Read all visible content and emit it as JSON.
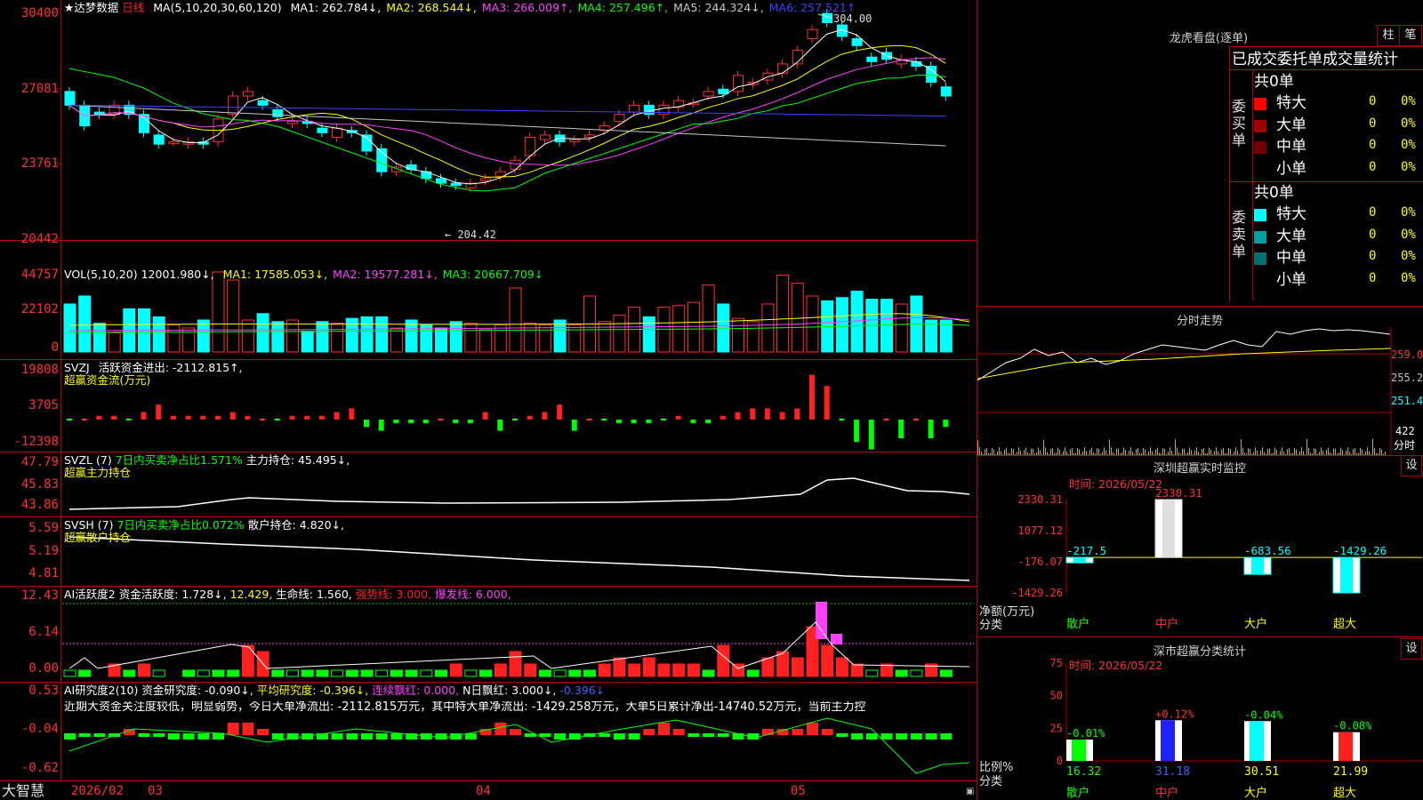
{
  "app": {
    "brand": "大智慧"
  },
  "stock": {
    "name": "达梦数据",
    "period": "日线"
  },
  "main": {
    "ma_header": "MA(5,10,20,30,60,120)",
    "ma": [
      {
        "label": "MA1: 262.784↓,",
        "color": "#ffffff"
      },
      {
        "label": "MA2: 268.544↓,",
        "color": "#ffff00"
      },
      {
        "label": "MA3: 266.009↑,",
        "color": "#ff40ff"
      },
      {
        "label": "MA4: 257.496↑,",
        "color": "#00ff00"
      },
      {
        "label": "MA5: 244.324↓,",
        "color": "#c8c8c8"
      },
      {
        "label": "MA6: 257.521↑",
        "color": "#4040ff"
      }
    ],
    "y_ticks": [
      "30400",
      "27081",
      "23761",
      "20442"
    ],
    "high_label": "304.00",
    "low_label": "204.42"
  },
  "vol": {
    "header": "VOL(5,10,20)",
    "value": "12001.980↓,",
    "ma": [
      {
        "label": "MA1: 17585.053↓,",
        "color": "#ffff00"
      },
      {
        "label": "MA2: 19577.281↓,",
        "color": "#ff40ff"
      },
      {
        "label": "MA3: 20667.709↓",
        "color": "#00ff00"
      }
    ],
    "y_ticks": [
      "44757",
      "22102",
      "0"
    ]
  },
  "svzj": {
    "line1_name": "SVZJ",
    "line1_value": "活跃资金进出: -2112.815↑,",
    "line2": "超赢资金流(万元)",
    "y_ticks": [
      "19808",
      "3705",
      "-12398"
    ]
  },
  "svzl": {
    "name": "SVZL (7)",
    "ratio": "7日内买卖净占比1.571%",
    "holding": "主力持仓: 45.495↓,",
    "line2": "超赢主力持仓",
    "y_ticks": [
      "47.79",
      "45.83",
      "43.86"
    ]
  },
  "svsh": {
    "name": "SVSH (7)",
    "ratio": "7日内买卖净占比0.072%",
    "holding": "散户持仓: 4.820↓,",
    "line2": "超赢散户持仓",
    "y_ticks": [
      "5.59",
      "5.19",
      "4.81"
    ]
  },
  "ai_active": {
    "name": "AI活跃度2",
    "activity": "资金活跃度: 1.728↓,",
    "v2": "12.429,",
    "life": "生命线: 1.560,",
    "strong": "强势线: 3.000,",
    "burst": "爆发线: 6.000,",
    "y_ticks": [
      "12.43",
      "6.14",
      "0.00"
    ]
  },
  "ai_research": {
    "name": "AI研究度2(10)",
    "research": "资金研究度: -0.090↓,",
    "avg": "平均研究度: -0.396↓,",
    "red": "连续飘红: 0.000,",
    "nred": "N日飘红: 3.000↓,",
    "last": "-0.396↓",
    "note": "近期大资金关注度较低，明显弱势，今日大单净流出: -2112.815万元，其中特大单净流出: -1429.258万元，大单5日累计净出-14740.52万元，当前主力控",
    "y_ticks": [
      "0.53",
      "-0.04",
      "-0.62"
    ]
  },
  "x_axis": {
    "labels": [
      "2026/02",
      "03",
      "04",
      "05"
    ]
  },
  "dragon_tiger": {
    "title": "龙虎看盘(逐单)",
    "btn_bar": "柱",
    "btn_pen": "笔",
    "tab_stats": "已成交委托单成交量统计",
    "buy_label": "委买单",
    "sell_label": "委卖单",
    "buy_total": "共0单",
    "sell_total": "共0单",
    "rows": [
      {
        "name": "特大",
        "count": "0",
        "pct": "0%"
      },
      {
        "name": "大单",
        "count": "0",
        "pct": "0%"
      },
      {
        "name": "中单",
        "count": "0",
        "pct": "0%"
      },
      {
        "name": "小单",
        "count": "0",
        "pct": "0%"
      }
    ],
    "buy_colors": [
      "#ff0000",
      "#a00000",
      "#700000",
      "#000000"
    ],
    "sell_colors": [
      "#00ffff",
      "#00a0a0",
      "#007070",
      "#000000"
    ]
  },
  "intraday": {
    "title": "分时走势",
    "price_ticks": [
      "259.0",
      "255.2",
      "251.4"
    ],
    "vol_tick": "422",
    "vol_unit": "分时"
  },
  "sz_monitor": {
    "title": "深圳超赢实时监控",
    "settings": "设",
    "time": "时间: 2026/05/22",
    "y_ticks": [
      "2330.31",
      "1077.12",
      "-176.07",
      "-1429.26"
    ],
    "unit": "净额(万元)",
    "cat_label": "分类",
    "chart_data": {
      "type": "bar",
      "categories": [
        "散户",
        "中户",
        "大户",
        "超大"
      ],
      "values": [
        -217.5,
        2330.31,
        -683.56,
        -1429.26
      ],
      "value_labels": [
        "-217.5",
        "2330.31",
        "-683.56",
        "-1429.26"
      ]
    }
  },
  "sz_class": {
    "title": "深市超赢分类统计",
    "settings": "设",
    "time": "时间: 2026/05/22",
    "y_ticks": [
      "75",
      "50",
      "25",
      "0"
    ],
    "unit": "比例%",
    "cat_label": "分类",
    "chart_data": {
      "type": "bar",
      "categories": [
        "散户",
        "中户",
        "大户",
        "超大"
      ],
      "values": [
        16.32,
        31.18,
        30.51,
        21.99
      ],
      "changes": [
        "-0.01%",
        "+0.12%",
        "-0.04%",
        "-0.08%"
      ],
      "value_labels": [
        "16.32",
        "31.18",
        "30.51",
        "21.99"
      ]
    }
  }
}
